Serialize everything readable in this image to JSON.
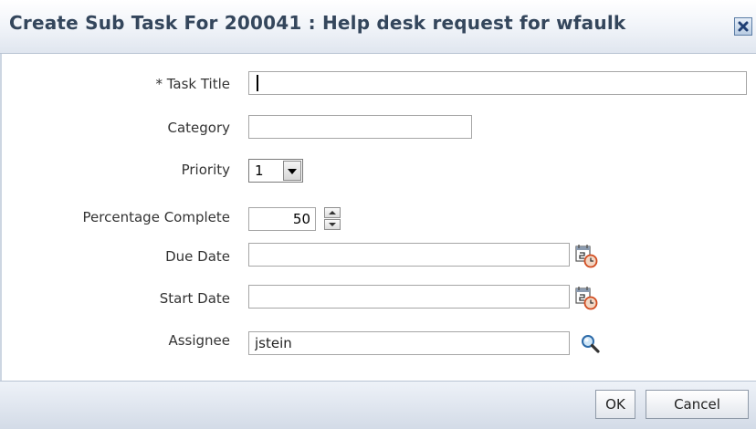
{
  "dialog": {
    "title": "Create Sub Task For 200041 : Help desk request for wfaulk",
    "close_icon": "close-icon"
  },
  "form": {
    "task_title": {
      "label": "* Task Title",
      "value": ""
    },
    "category": {
      "label": "Category",
      "value": ""
    },
    "priority": {
      "label": "Priority",
      "value": "1"
    },
    "percentage_complete": {
      "label": "Percentage Complete",
      "value": "50"
    },
    "due_date": {
      "label": "Due Date",
      "value": "",
      "icon": "calendar-icon"
    },
    "start_date": {
      "label": "Start Date",
      "value": "",
      "icon": "calendar-icon"
    },
    "assignee": {
      "label": "Assignee",
      "value": "jstein",
      "icon": "search-icon"
    }
  },
  "buttons": {
    "ok": "OK",
    "cancel": "Cancel"
  }
}
